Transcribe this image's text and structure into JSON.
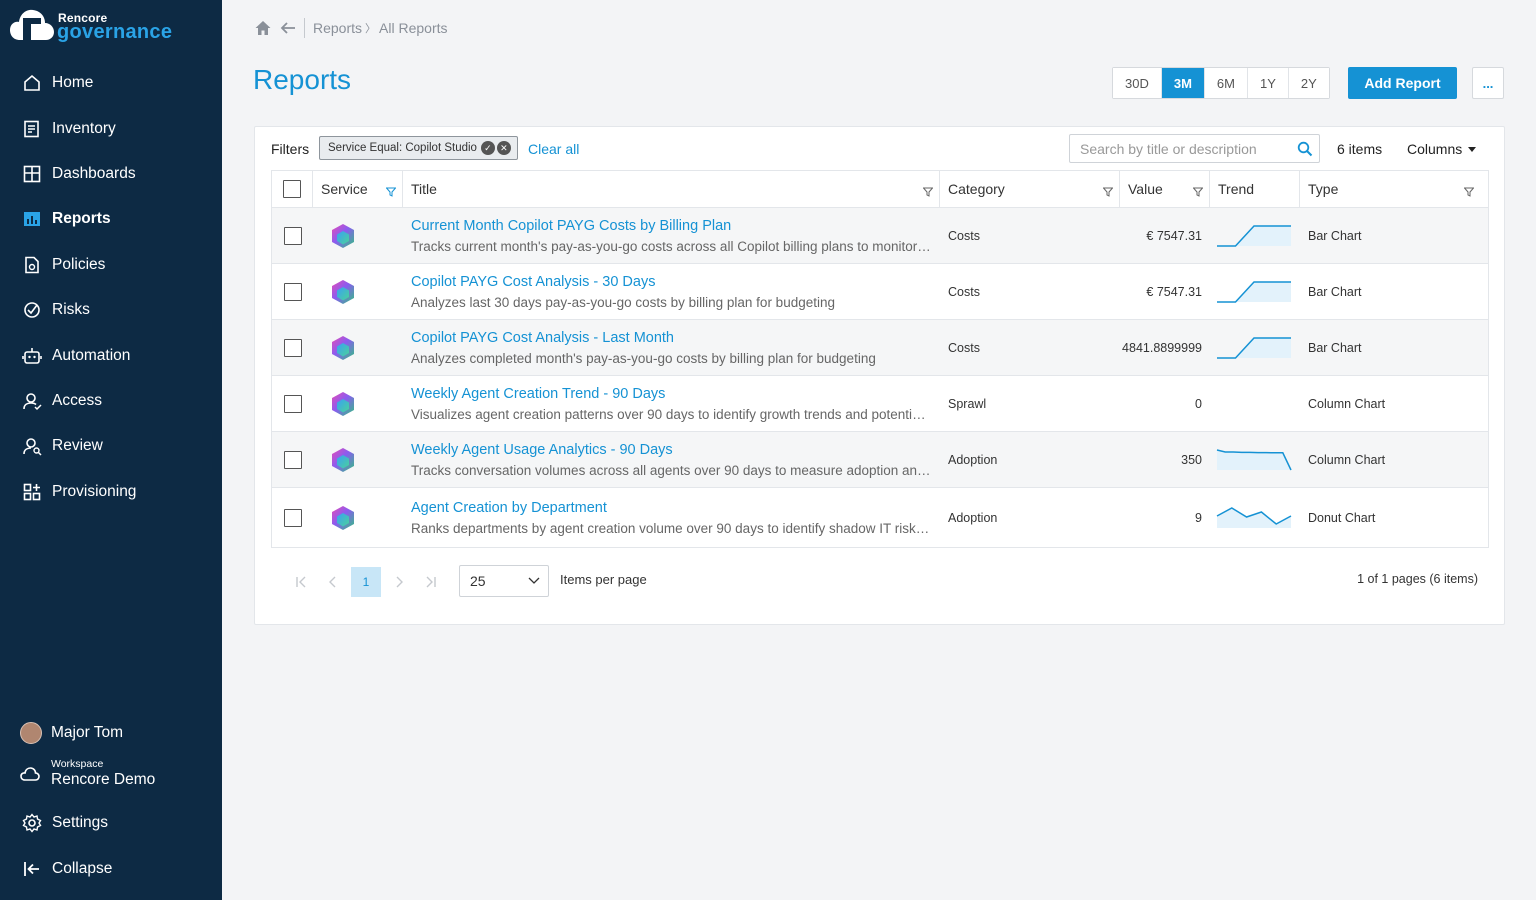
{
  "app": {
    "brand_top": "Rencore",
    "brand_bottom": "governance"
  },
  "sidebar": {
    "items": [
      {
        "label": "Home",
        "icon": "home-icon"
      },
      {
        "label": "Inventory",
        "icon": "inventory-icon"
      },
      {
        "label": "Dashboards",
        "icon": "dashboards-icon"
      },
      {
        "label": "Reports",
        "icon": "reports-icon",
        "active": true
      },
      {
        "label": "Policies",
        "icon": "policies-icon"
      },
      {
        "label": "Risks",
        "icon": "risks-icon"
      },
      {
        "label": "Automation",
        "icon": "automation-icon"
      },
      {
        "label": "Access",
        "icon": "access-icon"
      },
      {
        "label": "Review",
        "icon": "review-icon"
      },
      {
        "label": "Provisioning",
        "icon": "provisioning-icon"
      }
    ],
    "user": "Major Tom",
    "workspace_label": "Workspace",
    "workspace_name": "Rencore Demo",
    "settings": "Settings",
    "collapse": "Collapse"
  },
  "breadcrumb": {
    "parent": "Reports",
    "separator": "〉",
    "current": "All Reports"
  },
  "page_title": "Reports",
  "periods": [
    "30D",
    "3M",
    "6M",
    "1Y",
    "2Y"
  ],
  "active_period": "3M",
  "add_report": "Add Report",
  "more": "...",
  "filters": {
    "label": "Filters",
    "chip": "Service Equal: Copilot Studio",
    "clear": "Clear all"
  },
  "search": {
    "placeholder": "Search by title or description"
  },
  "items_count": "6 items",
  "columns_label": "Columns",
  "table": {
    "headers": {
      "service": "Service",
      "title": "Title",
      "category": "Category",
      "value": "Value",
      "trend": "Trend",
      "type": "Type"
    },
    "rows": [
      {
        "title": "Current Month Copilot PAYG Costs by Billing Plan",
        "desc": "Tracks current month's pay-as-you-go costs across all Copilot billing plans to monitor s…",
        "category": "Costs",
        "value": "€ 7547.31",
        "type": "Bar Chart",
        "trend": [
          0,
          0,
          1,
          1,
          1
        ]
      },
      {
        "title": "Copilot PAYG Cost Analysis - 30 Days",
        "desc": "Analyzes last 30 days pay-as-you-go costs by billing plan for budgeting",
        "category": "Costs",
        "value": "€ 7547.31",
        "type": "Bar Chart",
        "trend": [
          0,
          0,
          1,
          1,
          1
        ]
      },
      {
        "title": "Copilot PAYG Cost Analysis - Last Month",
        "desc": "Analyzes completed month's pay-as-you-go costs by billing plan for budgeting",
        "category": "Costs",
        "value": "€ 4841.8899999",
        "type": "Bar Chart",
        "trend": [
          0,
          0,
          1,
          1,
          1
        ]
      },
      {
        "title": "Weekly Agent Creation Trend - 90 Days",
        "desc": "Visualizes agent creation patterns over 90 days to identify growth trends and potential …",
        "category": "Sprawl",
        "value": "0",
        "type": "Column Chart",
        "trend": []
      },
      {
        "title": "Weekly Agent Usage Analytics - 90 Days",
        "desc": "Tracks conversation volumes across all agents over 90 days to measure adoption and i…",
        "category": "Adoption",
        "value": "350",
        "type": "Column Chart",
        "trend": [
          1,
          0.9,
          0.9,
          0.88,
          0.88,
          0.87,
          0.87,
          0.86,
          0.86,
          0
        ]
      },
      {
        "title": "Agent Creation by Department",
        "desc": "Ranks departments by agent creation volume over 90 days to identify shadow IT risks a…",
        "category": "Adoption",
        "value": "9",
        "type": "Donut Chart",
        "trend": [
          0.6,
          1,
          0.55,
          0.8,
          0.2,
          0.6
        ]
      }
    ]
  },
  "pagination": {
    "first": "⟨⟨",
    "prev": "‹",
    "page": "1",
    "next": "›",
    "last": "⟩⟩",
    "per_page_value": "25",
    "per_page_label": "Items per page",
    "info": "1 of 1 pages (6 items)"
  },
  "colors": {
    "sidebar": "#0d2a44",
    "accent": "#1592d4"
  }
}
